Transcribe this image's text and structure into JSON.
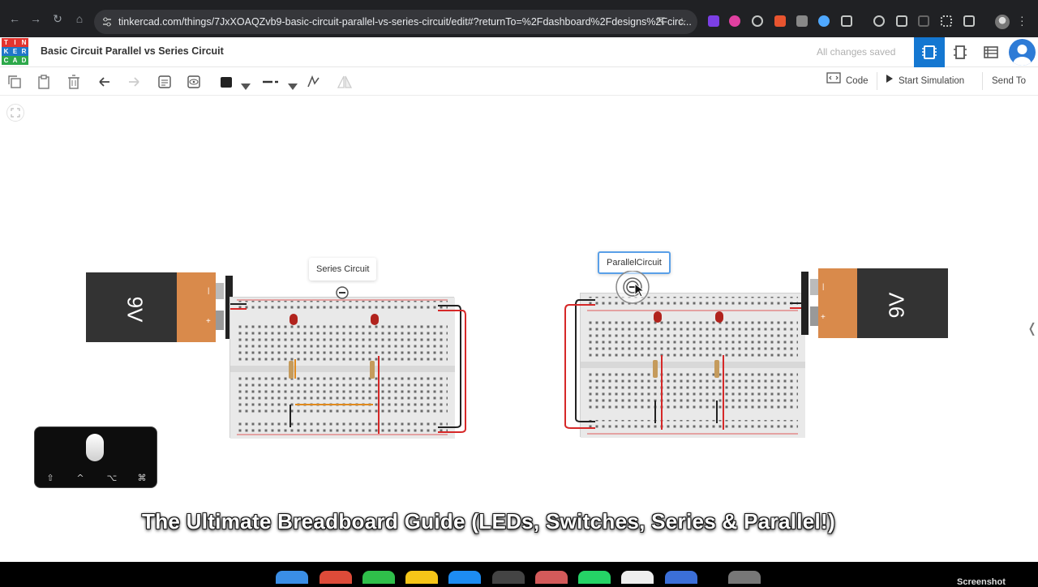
{
  "browser": {
    "url": "tinkercad.com/things/7JxXOAQZvb9-basic-circuit-parallel-vs-series-circuit/edit#?returnTo=%2Fdashboard%2Fdesigns%2Fcirc..."
  },
  "app": {
    "logo_letters": [
      "T",
      "I",
      "N",
      "K",
      "E",
      "R",
      "C",
      "A",
      "D"
    ],
    "logo_colors": [
      "#e3342f",
      "#e3342f",
      "#e3342f",
      "#1f77c9",
      "#1f77c9",
      "#1f77c9",
      "#2da84a",
      "#2da84a",
      "#2da84a"
    ],
    "design_title": "Basic Circuit Parallel vs Series Circuit",
    "save_status": "All changes saved",
    "accent_color": "#1477d1"
  },
  "toolbar": {
    "tools": [
      "copy-icon",
      "paste-icon",
      "delete-icon",
      "undo-icon",
      "redo-icon",
      "notes-icon",
      "show-notes-icon",
      "color-swatch-icon",
      "line-style-icon",
      "flip-icon",
      "mirror-icon"
    ],
    "code_label": "Code",
    "simulate_label": "Start Simulation",
    "send_label": "Send To"
  },
  "canvas": {
    "series_label": "Series Circuit",
    "parallel_label": "ParallelCircuit",
    "battery_label": "9V",
    "battery_colors": {
      "body": "#333333",
      "cap": "#d98a4b"
    },
    "wire_colors": {
      "positive": "#d62828",
      "negative": "#222222"
    }
  },
  "overlay": {
    "keys": [
      "⇧",
      "^",
      "⌥",
      "⌘"
    ]
  },
  "caption": {
    "text": "The Ultimate Breadboard Guide (LEDs, Switches, Series & Parallel!)"
  },
  "dock": {
    "label": "Screenshot"
  }
}
